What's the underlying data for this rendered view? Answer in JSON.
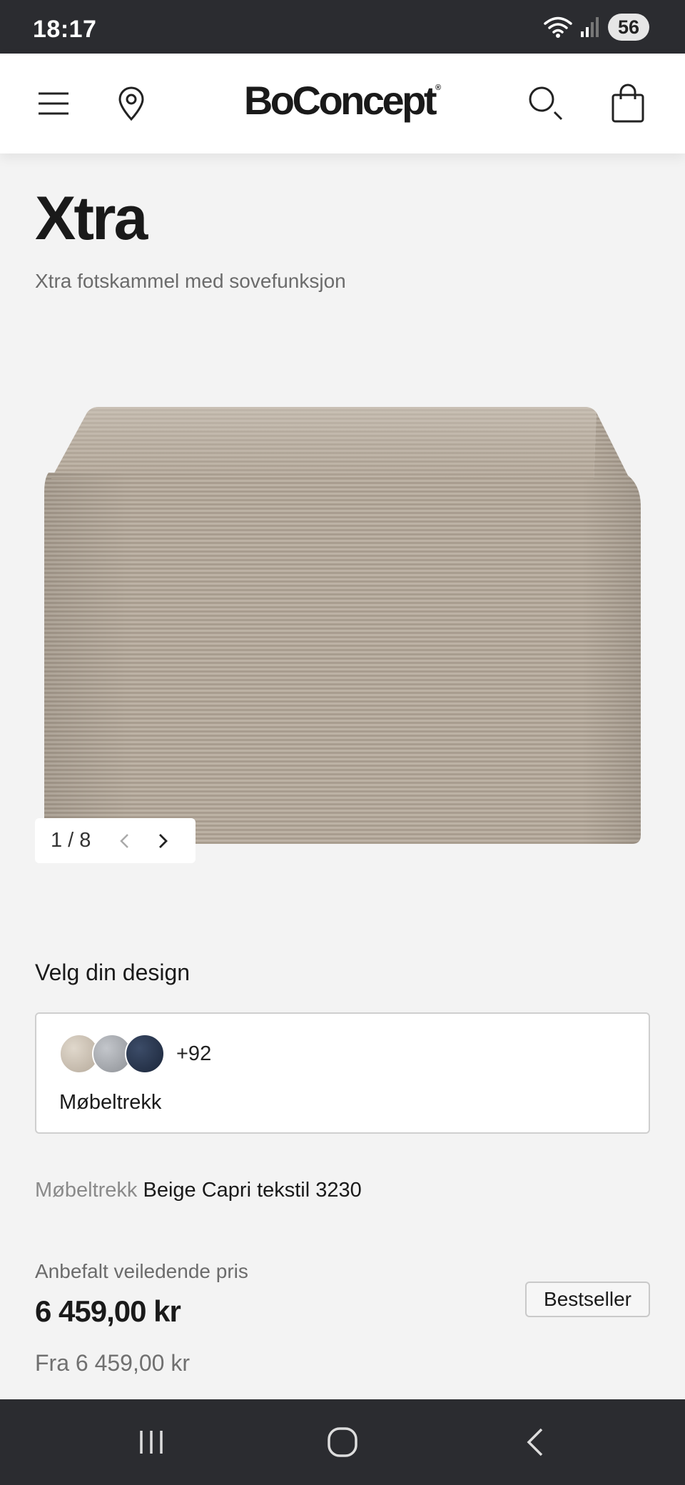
{
  "status_bar": {
    "time": "18:17",
    "battery": "56",
    "icons": [
      "wifi-icon",
      "signal-icon",
      "battery-icon"
    ]
  },
  "header": {
    "logo": "BoConcept",
    "logo_mark": "®",
    "icons": [
      "menu-icon",
      "location-pin-icon",
      "search-icon",
      "shopping-bag-icon"
    ]
  },
  "product": {
    "title": "Xtra",
    "subtitle": "Xtra fotskammel med sovefunksjon",
    "gallery": {
      "counter": "1 / 8",
      "current": 1,
      "total": 8
    }
  },
  "design": {
    "section_title": "Velg din design",
    "swatch_colors": [
      "#c9bfb2",
      "#a3a6ab",
      "#26344c"
    ],
    "more_label": "+92",
    "label": "Møbeltrekk"
  },
  "fabric": {
    "key": "Møbeltrekk",
    "value": "Beige Capri tekstil 3230"
  },
  "pricing": {
    "caption": "Anbefalt veiledende pris",
    "price": "6 459,00 kr",
    "from": "Fra 6 459,00 kr",
    "badge": "Bestseller"
  },
  "nav_bar": {
    "icons": [
      "recent-apps-icon",
      "home-icon",
      "back-icon"
    ]
  },
  "colors": {
    "status_bg": "#2b2c30",
    "page_bg": "#f3f3f3",
    "fabric": "#b3a89a"
  }
}
